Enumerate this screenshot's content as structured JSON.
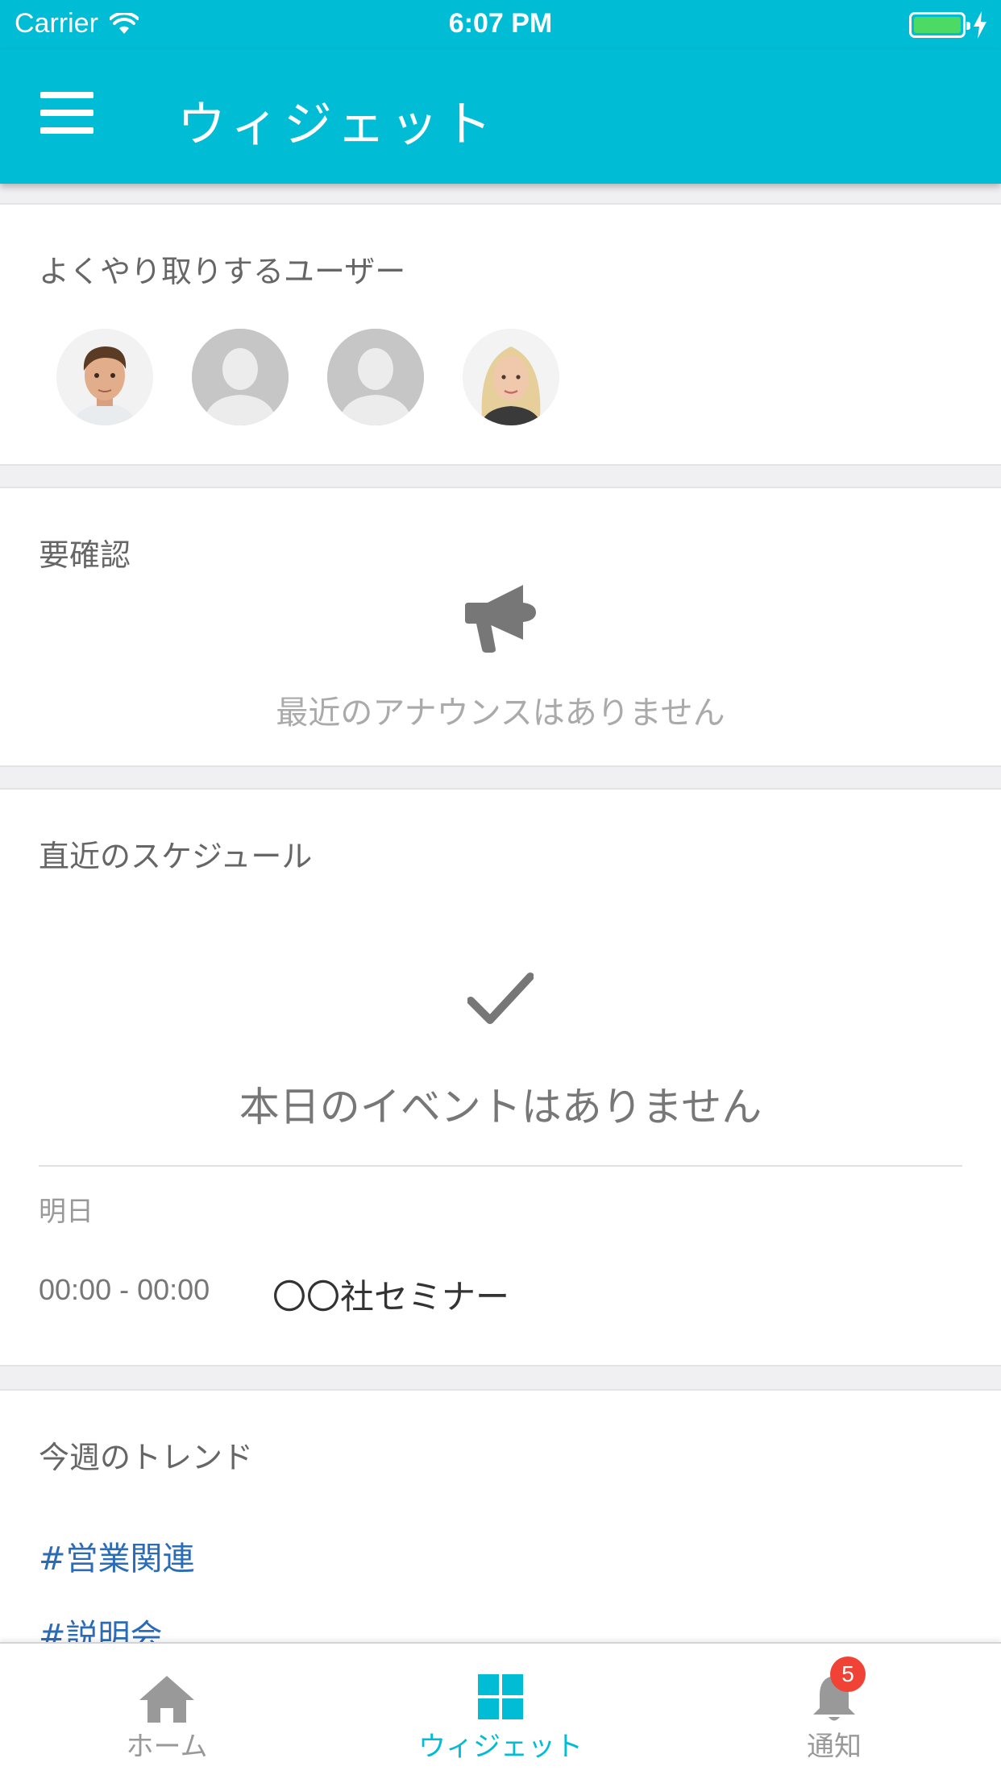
{
  "status_bar": {
    "carrier": "Carrier",
    "time": "6:07 PM",
    "wifi_icon": "wifi-icon",
    "battery_icon": "battery-charging-icon"
  },
  "header": {
    "title": "ウィジェット",
    "menu_icon": "hamburger-menu-icon",
    "color": "#00bcd4"
  },
  "frequent_users": {
    "title": "よくやり取りするユーザー",
    "users": [
      {
        "avatar": "male-photo"
      },
      {
        "avatar": "placeholder"
      },
      {
        "avatar": "placeholder"
      },
      {
        "avatar": "female-photo"
      }
    ]
  },
  "attention": {
    "title": "要確認",
    "icon": "megaphone-icon",
    "empty_text": "最近のアナウンスはありません"
  },
  "schedule": {
    "title": "直近のスケジュール",
    "icon": "checkmark-icon",
    "empty_today_text": "本日のイベントはありません",
    "tomorrow_label": "明日",
    "events": [
      {
        "time": "00:00 - 00:00",
        "name": "〇〇社セミナー"
      }
    ]
  },
  "trends": {
    "title": "今週のトレンド",
    "tags": [
      "#営業関連",
      "#説明会"
    ],
    "tag_color": "#2a6cb8"
  },
  "tab_bar": {
    "tabs": [
      {
        "label": "ホーム",
        "icon": "home-icon"
      },
      {
        "label": "ウィジェット",
        "icon": "grid-icon",
        "active": true
      },
      {
        "label": "通知",
        "icon": "bell-icon",
        "badge": "5"
      }
    ],
    "active_color": "#00bcd4",
    "badge_color": "#f04336"
  }
}
